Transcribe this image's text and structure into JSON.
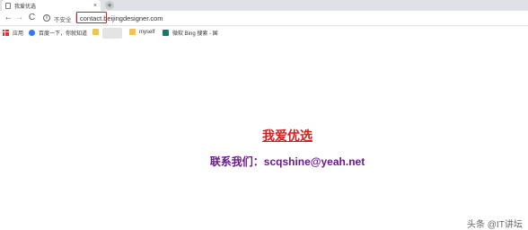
{
  "tab": {
    "title": "我爱优选",
    "close": "×",
    "new_tab": "+"
  },
  "toolbar": {
    "back": "←",
    "forward": "→",
    "reload": "C",
    "info": "i",
    "security_label": "不安全",
    "url": "contact.beijingdesigner.com"
  },
  "bookmarks": [
    {
      "label": "应用",
      "icon": "apps-icon"
    },
    {
      "label": "百度一下，你就知道",
      "icon": "paw-icon"
    },
    {
      "label": "",
      "icon": "folder-icon"
    },
    {
      "label": "myself",
      "icon": "folder-icon"
    },
    {
      "label": "微软 Bing 搜索 - 国",
      "icon": "bing-icon"
    }
  ],
  "page": {
    "headline": "我爱优选",
    "contact": "联系我们：scqshine@yeah.net"
  },
  "watermark": "头条 @IT讲坛",
  "colors": {
    "headline": "#d81b1b",
    "contact": "#6b1a8a",
    "url_highlight": "#d2202a"
  }
}
